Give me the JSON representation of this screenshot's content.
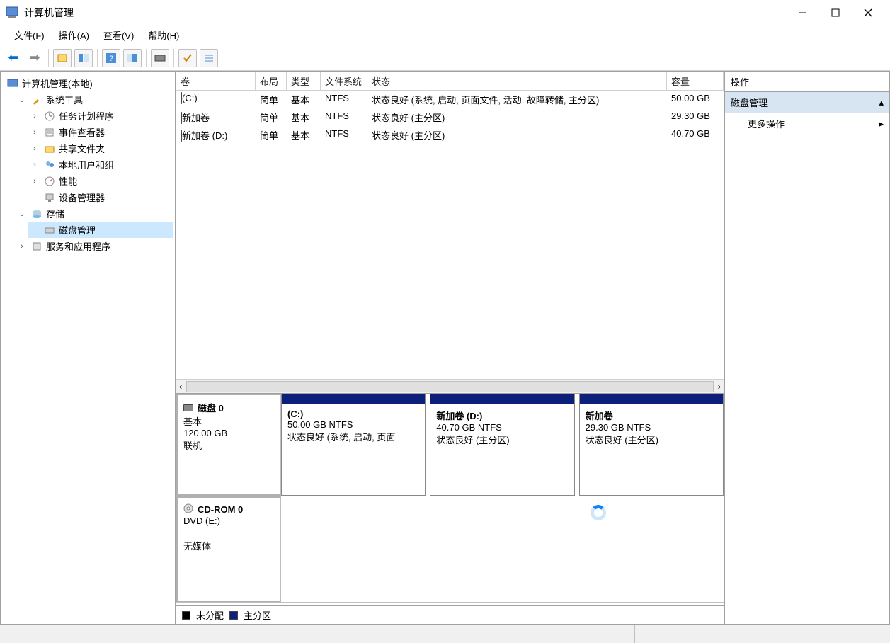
{
  "window": {
    "title": "计算机管理"
  },
  "menus": {
    "file": "文件(F)",
    "action": "操作(A)",
    "view": "查看(V)",
    "help": "帮助(H)"
  },
  "tree": {
    "root": "计算机管理(本地)",
    "system_tools": "系统工具",
    "task_scheduler": "任务计划程序",
    "event_viewer": "事件查看器",
    "shared_folders": "共享文件夹",
    "local_users": "本地用户和组",
    "performance": "性能",
    "device_manager": "设备管理器",
    "storage": "存储",
    "disk_management": "磁盘管理",
    "services": "服务和应用程序"
  },
  "vol_headers": {
    "vol": "卷",
    "layout": "布局",
    "type": "类型",
    "fs": "文件系统",
    "status": "状态",
    "cap": "容量"
  },
  "volumes": [
    {
      "vol": "(C:)",
      "layout": "简单",
      "type": "基本",
      "fs": "NTFS",
      "status": "状态良好 (系统, 启动, 页面文件, 活动, 故障转储, 主分区)",
      "cap": "50.00 GB"
    },
    {
      "vol": "新加卷",
      "layout": "简单",
      "type": "基本",
      "fs": "NTFS",
      "status": "状态良好 (主分区)",
      "cap": "29.30 GB"
    },
    {
      "vol": "新加卷 (D:)",
      "layout": "简单",
      "type": "基本",
      "fs": "NTFS",
      "status": "状态良好 (主分区)",
      "cap": "40.70 GB"
    }
  ],
  "disk0": {
    "title": "磁盘 0",
    "type": "基本",
    "size": "120.00 GB",
    "status": "联机",
    "partitions": [
      {
        "name": "(C:)",
        "size": "50.00 GB NTFS",
        "status": "状态良好 (系统, 启动, 页面"
      },
      {
        "name": "新加卷  (D:)",
        "size": "40.70 GB NTFS",
        "status": "状态良好 (主分区)"
      },
      {
        "name": "新加卷",
        "size": "29.30 GB NTFS",
        "status": "状态良好 (主分区)"
      }
    ]
  },
  "cdrom": {
    "title": "CD-ROM 0",
    "type": "DVD (E:)",
    "status": "无媒体"
  },
  "legend": {
    "unalloc": "未分配",
    "primary": "主分区"
  },
  "actions": {
    "header": "操作",
    "section": "磁盘管理",
    "more": "更多操作"
  }
}
